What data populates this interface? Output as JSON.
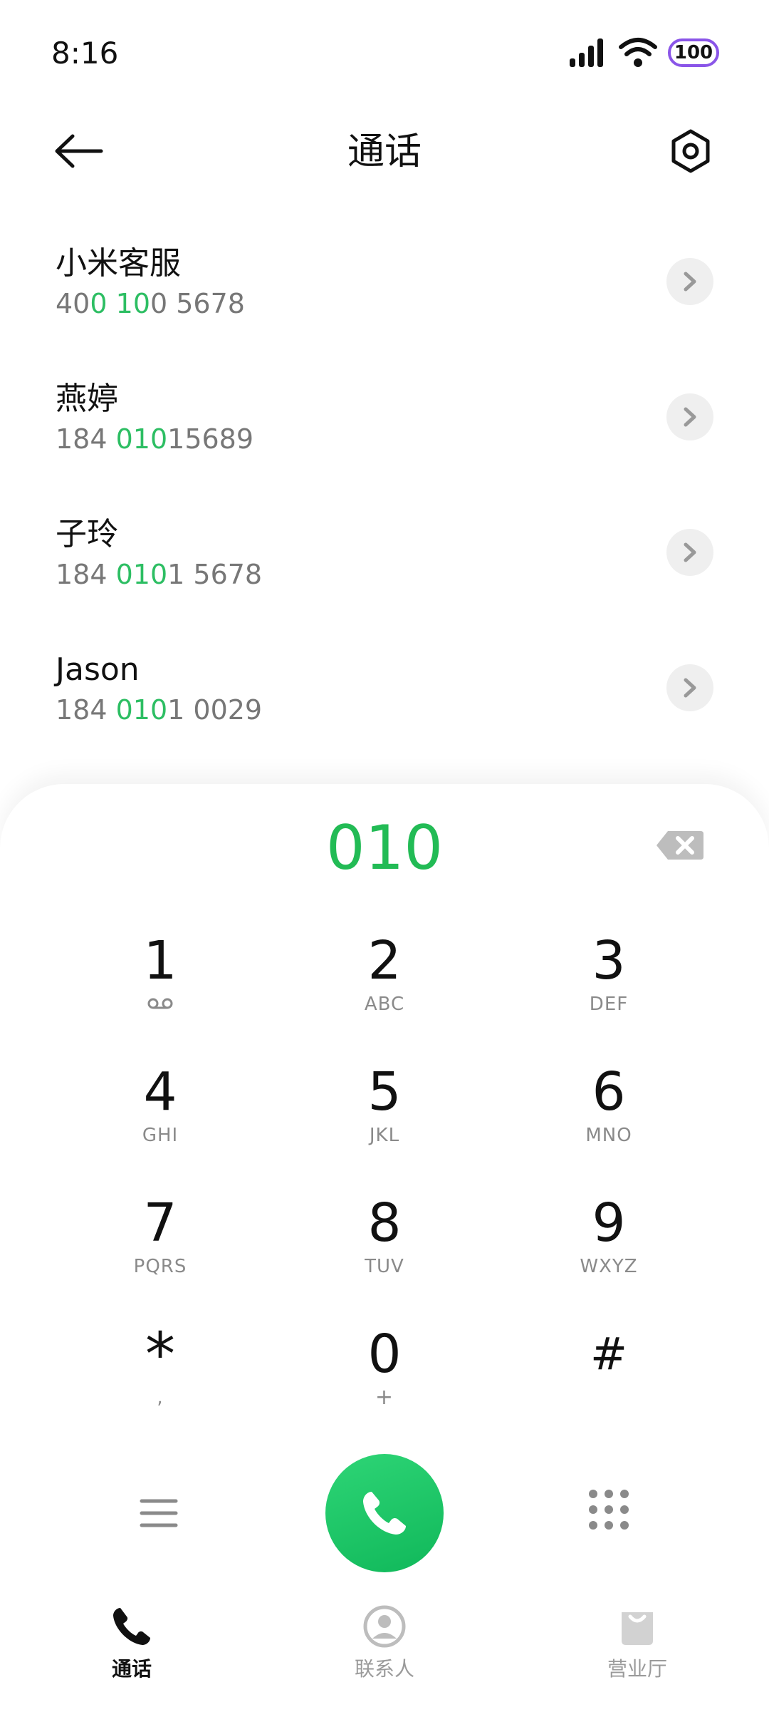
{
  "status_bar": {
    "time": "8:16",
    "battery": "100",
    "accent": "#8a55e8"
  },
  "header": {
    "title": "通话",
    "back_icon": "arrow-left-icon",
    "settings_icon": "hexagon-settings-icon"
  },
  "results": [
    {
      "name": "小米客服",
      "number_parts": [
        [
          "40",
          false
        ],
        [
          "0",
          true
        ],
        [
          " ",
          false
        ],
        [
          "10",
          true
        ],
        [
          "0 5678",
          false
        ]
      ]
    },
    {
      "name": "燕婷",
      "number_parts": [
        [
          "184 ",
          false
        ],
        [
          "010",
          true
        ],
        [
          "15689",
          false
        ]
      ]
    },
    {
      "name": "子玲",
      "number_parts": [
        [
          "184 ",
          false
        ],
        [
          "010",
          true
        ],
        [
          "1 5678",
          false
        ]
      ]
    },
    {
      "name": "Jason",
      "number_parts": [
        [
          "184 ",
          false
        ],
        [
          "010",
          true
        ],
        [
          "1 0029",
          false
        ]
      ]
    }
  ],
  "dialpad": {
    "input": "010",
    "highlight_color": "#2dbe63",
    "keys": [
      {
        "digit": "1",
        "letters": "voicemail-icon"
      },
      {
        "digit": "2",
        "letters": "ABC"
      },
      {
        "digit": "3",
        "letters": "DEF"
      },
      {
        "digit": "4",
        "letters": "GHI"
      },
      {
        "digit": "5",
        "letters": "JKL"
      },
      {
        "digit": "6",
        "letters": "MNO"
      },
      {
        "digit": "7",
        "letters": "PQRS"
      },
      {
        "digit": "8",
        "letters": "TUV"
      },
      {
        "digit": "9",
        "letters": "WXYZ"
      },
      {
        "digit": "*",
        "letters": ","
      },
      {
        "digit": "0",
        "letters": "+"
      },
      {
        "digit": "#",
        "letters": ""
      }
    ]
  },
  "nav": [
    {
      "label": "通话",
      "icon": "phone-icon",
      "active": true
    },
    {
      "label": "联系人",
      "icon": "contact-icon",
      "active": false
    },
    {
      "label": "营业厅",
      "icon": "shopping-bag-icon",
      "active": false
    }
  ],
  "colors": {
    "active_nav": "#111111",
    "inactive_nav": "#9a9a9a",
    "call_button": "#1fc766"
  }
}
